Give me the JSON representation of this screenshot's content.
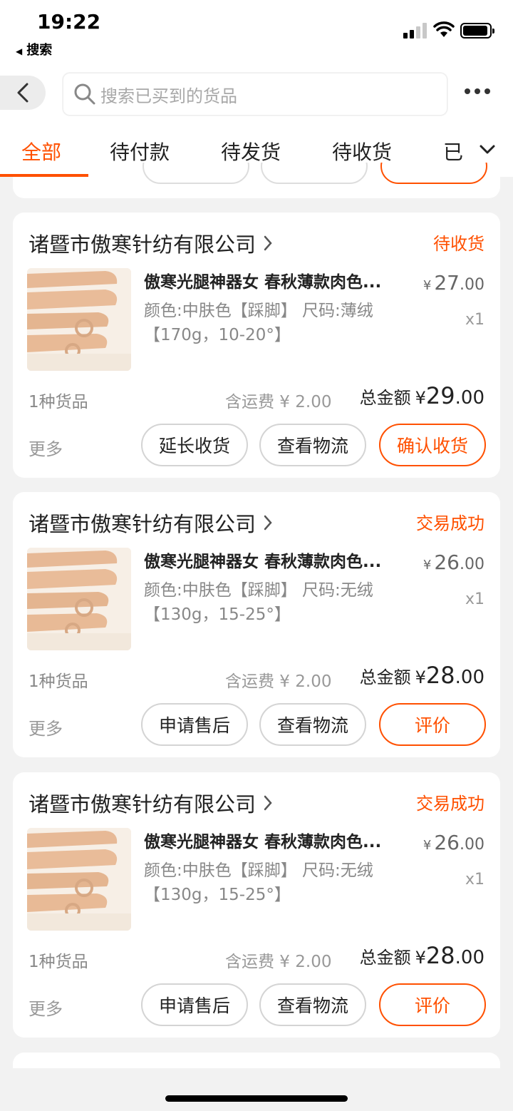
{
  "status_bar": {
    "time": "19:22",
    "back_app": "搜索"
  },
  "header": {
    "search_placeholder": "搜索已买到的货品"
  },
  "tabs": [
    {
      "label": "全部",
      "active": true
    },
    {
      "label": "待付款",
      "active": false
    },
    {
      "label": "待发货",
      "active": false
    },
    {
      "label": "待收货",
      "active": false
    },
    {
      "label": "已",
      "active": false
    }
  ],
  "orders": [
    {
      "shop": "诸暨市傲寒针纺有限公司",
      "status": "待收货",
      "title": "傲寒光腿神器女 春秋薄款肉色...",
      "spec_line1": "颜色:中肤色【踩脚】 尺码:薄绒",
      "spec_line2": "【170g，10-20°】",
      "price_currency": "¥",
      "price_int": "27",
      "price_dec": ".00",
      "qty": "x1",
      "count": "1种货品",
      "shipping": "含运费 ¥ 2.00",
      "total_label": "总金额",
      "total_currency": "¥",
      "total_int": "29",
      "total_dec": ".00",
      "more": "更多",
      "buttons": [
        "延长收货",
        "查看物流",
        "确认收货"
      ]
    },
    {
      "shop": "诸暨市傲寒针纺有限公司",
      "status": "交易成功",
      "title": "傲寒光腿神器女 春秋薄款肉色...",
      "spec_line1": "颜色:中肤色【踩脚】 尺码:无绒",
      "spec_line2": "【130g，15-25°】",
      "price_currency": "¥",
      "price_int": "26",
      "price_dec": ".00",
      "qty": "x1",
      "count": "1种货品",
      "shipping": "含运费 ¥ 2.00",
      "total_label": "总金额",
      "total_currency": "¥",
      "total_int": "28",
      "total_dec": ".00",
      "more": "更多",
      "buttons": [
        "申请售后",
        "查看物流",
        "评价"
      ]
    },
    {
      "shop": "诸暨市傲寒针纺有限公司",
      "status": "交易成功",
      "title": "傲寒光腿神器女 春秋薄款肉色...",
      "spec_line1": "颜色:中肤色【踩脚】 尺码:无绒",
      "spec_line2": "【130g，15-25°】",
      "price_currency": "¥",
      "price_int": "26",
      "price_dec": ".00",
      "qty": "x1",
      "count": "1种货品",
      "shipping": "含运费 ¥ 2.00",
      "total_label": "总金额",
      "total_currency": "¥",
      "total_int": "28",
      "total_dec": ".00",
      "more": "更多",
      "buttons": [
        "申请售后",
        "查看物流",
        "评价"
      ]
    }
  ],
  "colors": {
    "accent": "#ff5000",
    "background": "#f2f2f2"
  }
}
